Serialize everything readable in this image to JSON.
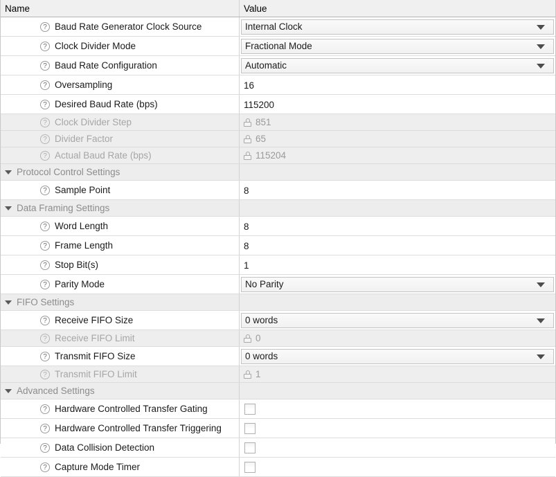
{
  "header": {
    "name_label": "Name",
    "value_label": "Value"
  },
  "icons": {
    "help": "?",
    "expander": "triangle-down-icon",
    "lock": "lock-icon",
    "dropdown": "chevron-down-icon"
  },
  "rows": [
    {
      "kind": "item",
      "label": "Baud Rate Generator Clock Source",
      "value": "Internal Clock",
      "control": "dropdown",
      "enabled": true
    },
    {
      "kind": "item",
      "label": "Clock Divider Mode",
      "value": "Fractional Mode",
      "control": "dropdown",
      "enabled": true
    },
    {
      "kind": "item",
      "label": "Baud Rate Configuration",
      "value": "Automatic",
      "control": "dropdown",
      "enabled": true
    },
    {
      "kind": "item",
      "label": "Oversampling",
      "value": "16",
      "control": "text",
      "enabled": true
    },
    {
      "kind": "item",
      "label": "Desired Baud Rate (bps)",
      "value": "115200",
      "control": "text",
      "enabled": true
    },
    {
      "kind": "item",
      "label": "Clock Divider Step",
      "value": "851",
      "control": "locked",
      "enabled": false
    },
    {
      "kind": "item",
      "label": "Divider Factor",
      "value": "65",
      "control": "locked",
      "enabled": false
    },
    {
      "kind": "item",
      "label": "Actual Baud Rate (bps)",
      "value": "115204",
      "control": "locked",
      "enabled": false
    },
    {
      "kind": "group",
      "label": "Protocol Control Settings",
      "value": "",
      "control": "none",
      "enabled": true
    },
    {
      "kind": "item",
      "label": "Sample Point",
      "value": "8",
      "control": "text",
      "enabled": true
    },
    {
      "kind": "group",
      "label": "Data Framing Settings",
      "value": "",
      "control": "none",
      "enabled": true
    },
    {
      "kind": "item",
      "label": "Word Length",
      "value": "8",
      "control": "text",
      "enabled": true
    },
    {
      "kind": "item",
      "label": "Frame Length",
      "value": "8",
      "control": "text",
      "enabled": true
    },
    {
      "kind": "item",
      "label": "Stop Bit(s)",
      "value": "1",
      "control": "text",
      "enabled": true
    },
    {
      "kind": "item",
      "label": "Parity Mode",
      "value": "No Parity",
      "control": "dropdown",
      "enabled": true
    },
    {
      "kind": "group",
      "label": "FIFO Settings",
      "value": "",
      "control": "none",
      "enabled": true
    },
    {
      "kind": "item",
      "label": "Receive FIFO Size",
      "value": "0 words",
      "control": "dropdown",
      "enabled": true
    },
    {
      "kind": "item",
      "label": "Receive FIFO Limit",
      "value": "0",
      "control": "locked",
      "enabled": false
    },
    {
      "kind": "item",
      "label": "Transmit FIFO Size",
      "value": "0 words",
      "control": "dropdown",
      "enabled": true
    },
    {
      "kind": "item",
      "label": "Transmit FIFO Limit",
      "value": "1",
      "control": "locked",
      "enabled": false
    },
    {
      "kind": "group",
      "label": "Advanced Settings",
      "value": "",
      "control": "none",
      "enabled": true
    },
    {
      "kind": "item",
      "label": "Hardware Controlled Transfer Gating",
      "value": "false",
      "control": "checkbox",
      "enabled": true
    },
    {
      "kind": "item",
      "label": "Hardware Controlled Transfer Triggering",
      "value": "false",
      "control": "checkbox",
      "enabled": true
    },
    {
      "kind": "item",
      "label": "Data Collision Detection",
      "value": "false",
      "control": "checkbox",
      "enabled": true
    },
    {
      "kind": "item",
      "label": "Capture Mode Timer",
      "value": "false",
      "control": "checkbox",
      "enabled": true
    }
  ],
  "colors": {
    "header_bg": "#f0f0f0",
    "group_bg": "#ededed",
    "disabled_bg": "#eeeeee",
    "grid_line": "#dcdcdc",
    "text": "#1a1a1a",
    "muted_text": "#8c8c8c"
  }
}
